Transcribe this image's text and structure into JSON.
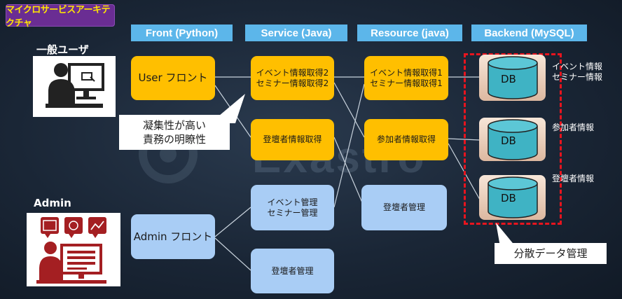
{
  "title_badge": "マイクロサービスアーキテクチャ",
  "columns": [
    "Front (Python)",
    "Service (Java)",
    "Resource (java)",
    "Backend (MySQL)"
  ],
  "actors": {
    "user": "一般ユーザ",
    "admin": "Admin"
  },
  "front": {
    "user": "User フロント",
    "admin": "Admin フロント"
  },
  "service": {
    "event_get": [
      "イベント情報取得2",
      "セミナー情報取得2"
    ],
    "speaker_get": "登壇者情報取得",
    "event_admin": [
      "イベント管理",
      "セミナー管理"
    ],
    "speaker_admin": "登壇者管理"
  },
  "resource": {
    "event_get": [
      "イベント情報取得1",
      "セミナー情報取得1"
    ],
    "participant_get": "参加者情報取得",
    "speaker_admin": "登壇者管理"
  },
  "db": {
    "label": "DB",
    "names": [
      [
        "イベント情報",
        "セミナー情報"
      ],
      [
        "参加者情報"
      ],
      [
        "登壇者情報"
      ]
    ]
  },
  "callout": [
    "凝集性が高い",
    "責務の明瞭性"
  ],
  "distributed_label": "分散データ管理",
  "watermark": "Exastro",
  "colors": {
    "header": "#5cb6ea",
    "yellow": "#ffbf00",
    "blue": "#a9cdf5",
    "red_dash": "#e8141e",
    "db_teal": "#3fb3c4",
    "actor_red": "#a41f22",
    "badge": "#6a2d93"
  }
}
